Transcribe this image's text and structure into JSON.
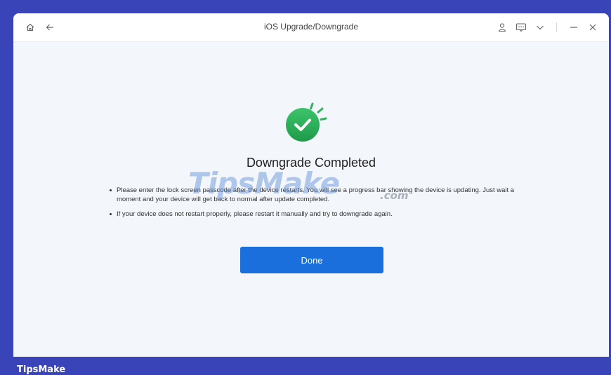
{
  "window": {
    "title": "iOS Upgrade/Downgrade"
  },
  "titlebar": {
    "icons": [
      "home-icon",
      "back-arrow-icon",
      "user-icon",
      "feedback-icon",
      "chevron-down-icon",
      "minimize-icon",
      "close-icon"
    ]
  },
  "result": {
    "headline": "Downgrade Completed",
    "notes": [
      "Please enter the lock screen passcode after the device restarts. You will see a progress bar showing the device is updating. Just wait a moment and your device will get back to normal after update completed.",
      "If your device does not restart properly, please restart it manually and try to downgrade again."
    ],
    "done_label": "Done"
  },
  "watermark": {
    "brand": "TipsMake",
    "suffix": ".com",
    "footer": "TipsMake"
  },
  "colors": {
    "accent": "#1b6fdc",
    "success": "#2fb35a",
    "frame": "#3a44b9"
  }
}
